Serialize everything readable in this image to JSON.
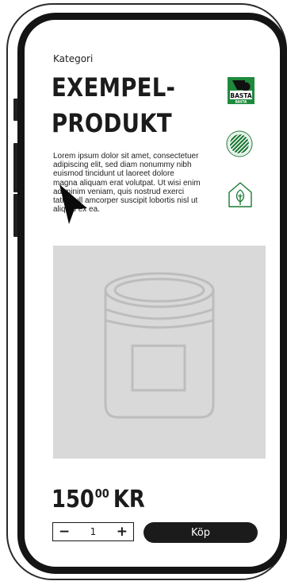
{
  "category": "Kategori",
  "product": {
    "title_line1": "EXEMPEL-",
    "title_line2": "PRODUKT",
    "description": "Lorem ipsum dolor sit amet, consectetuer adipiscing elit, sed diam nonummy nibh euismod tincidunt ut laoreet dolore magna aliquam erat volutpat. Ut wisi enim ad minim veniam, quis nostrud exerci tation ull amcorper suscipit lobortis nisl ut aliquip ex ea."
  },
  "badges": {
    "basta_label": "BASTA",
    "basta_sub": "BASTA",
    "swan_icon": "nordic-swan-ecolabel-icon",
    "leaf_icon": "leaf-house-icon",
    "basta_green": "#1e8a3c",
    "swan_green": "#1a7a33"
  },
  "image": {
    "icon": "jar-icon",
    "background": "#d9d9d9"
  },
  "price": {
    "amount": "150",
    "cents": "00",
    "currency": "KR"
  },
  "cart": {
    "minus": "−",
    "quantity": "1",
    "plus": "+",
    "buy_label": "Köp"
  }
}
